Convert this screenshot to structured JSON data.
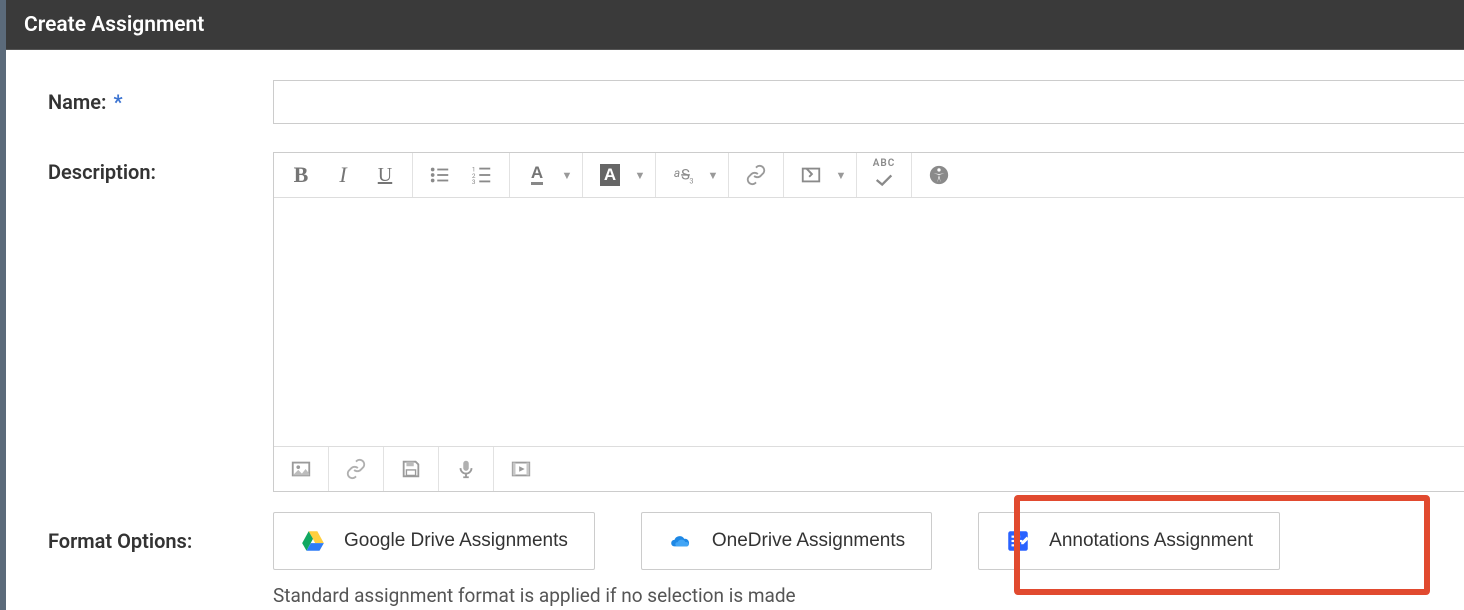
{
  "header": {
    "title": "Create Assignment"
  },
  "form": {
    "name_label": "Name:",
    "required_mark": "*",
    "description_label": "Description:",
    "format_label": "Format Options:",
    "hint": "Standard assignment format is applied if no selection is made"
  },
  "toolbar": {
    "abc": "ABC"
  },
  "format_options": {
    "google": "Google Drive Assignments",
    "onedrive": "OneDrive Assignments",
    "annotations": "Annotations Assignment"
  }
}
